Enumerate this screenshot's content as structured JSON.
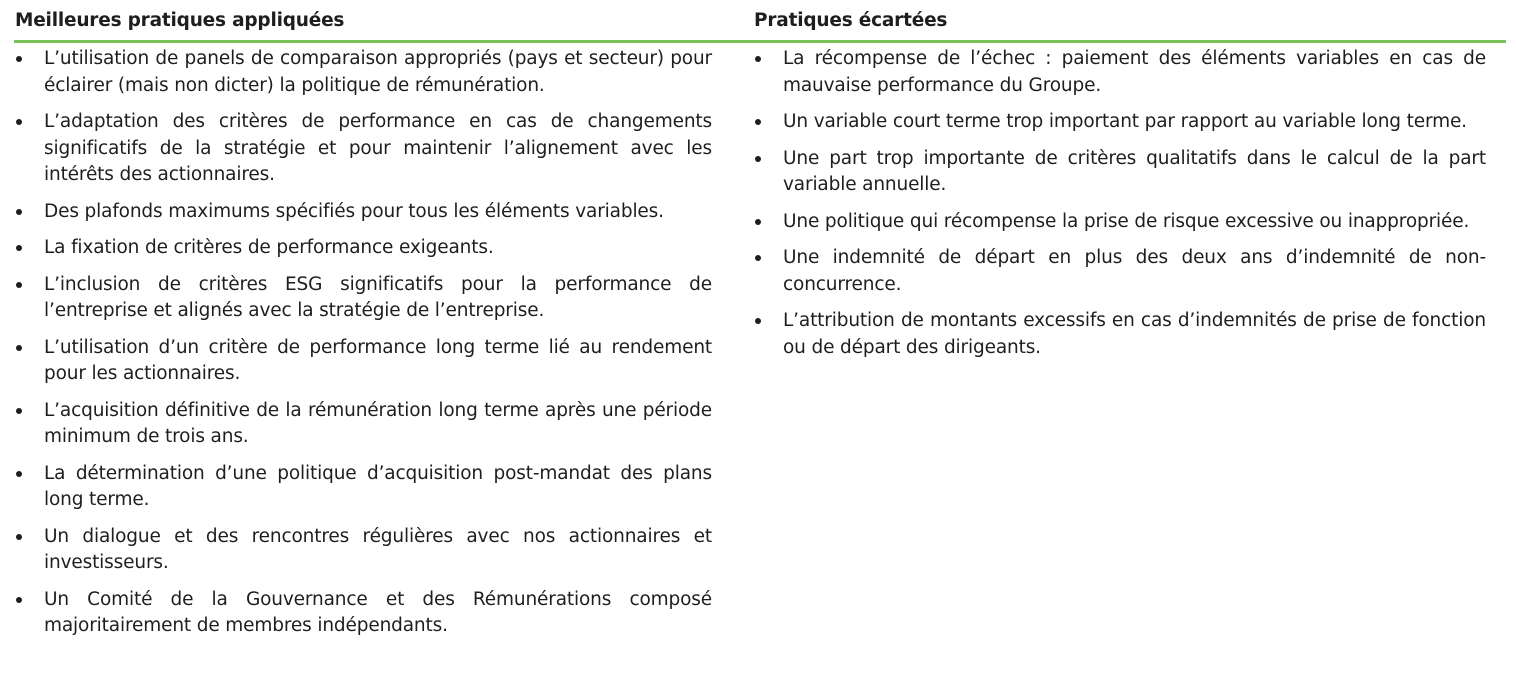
{
  "table": {
    "left_header": "Meilleures pratiques appliquées",
    "right_header": "Pratiques écartées",
    "left_items": [
      "L’utilisation de panels de comparaison appropriés (pays et secteur) pour éclairer (mais non dicter) la politique de rémunération.",
      "L’adaptation des critères de performance en cas de changements significatifs de la stratégie et pour maintenir l’alignement avec les intérêts des actionnaires.",
      "Des plafonds maximums spécifiés pour tous les éléments variables.",
      "La fixation de critères de performance exigeants.",
      "L’inclusion de critères ESG significatifs pour la performance de l’entreprise et alignés avec la stratégie de l’entreprise.",
      "L’utilisation d’un critère de performance long terme lié au rendement pour les actionnaires.",
      "L’acquisition définitive de la rémunération long terme après une période minimum de trois ans.",
      "La détermination d’une politique d’acquisition post-mandat des plans long terme.",
      "Un dialogue et des rencontres régulières avec nos actionnaires et investisseurs.",
      "Un Comité de la Gouvernance et des Rémunérations composé majoritairement de membres indépendants."
    ],
    "right_items": [
      "La récompense de l’échec : paiement des éléments variables en cas de mauvaise performance du Groupe.",
      "Un variable court terme trop important par rapport au variable long terme.",
      "Une part trop importante de critères qualitatifs dans le calcul de la part variable annuelle.",
      "Une politique qui récompense la prise de risque excessive ou inappropriée.",
      "Une indemnité de départ en plus des deux ans d’indemnité de non-concurrence.",
      "L’attribution de montants excessifs en cas d’indemnités de prise de fonction ou de départ des dirigeants."
    ]
  },
  "colors": {
    "accent_line": "#78c35a",
    "text": "#1e1e1e"
  }
}
